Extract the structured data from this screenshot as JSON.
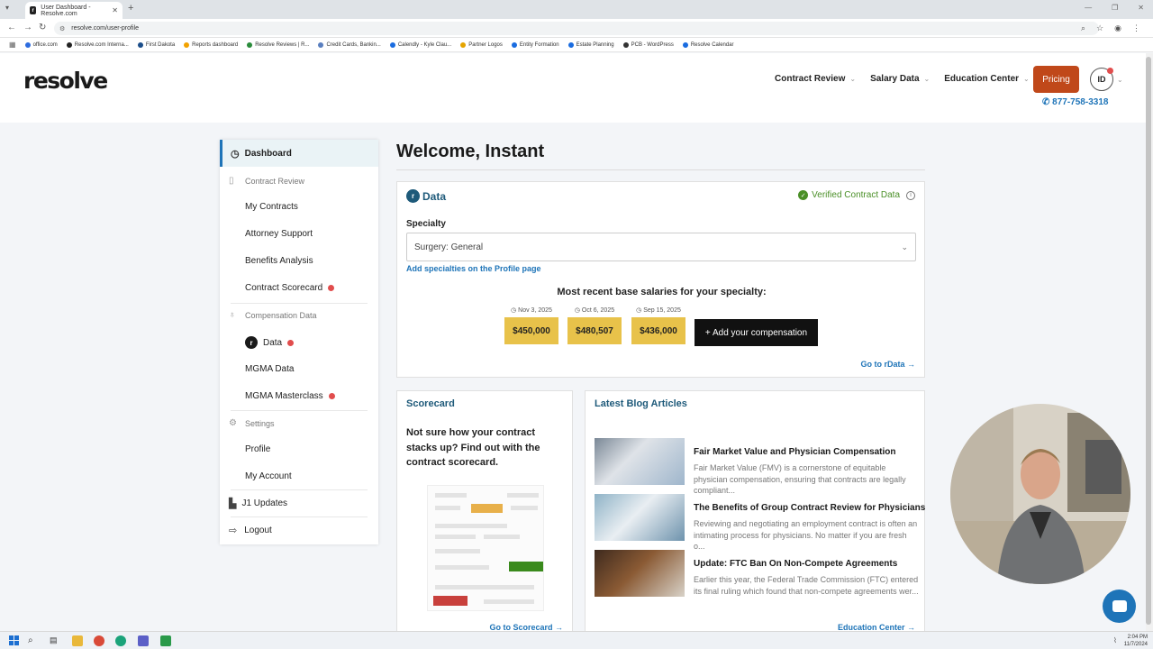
{
  "browser": {
    "tab_title": "User Dashboard - Resolve.com",
    "url": "resolve.com/user-profile",
    "bookmarks": [
      "office.com",
      "Resolve.com Interna...",
      "First Dakota",
      "Reports dashboard",
      "Resolve Reviews | R...",
      "Credit Cards, Bankin...",
      "Calendly - Kyle Clau...",
      "Partner Logos",
      "Entity Formation",
      "Estate Planning",
      "PCB - WordPress",
      "Resolve Calendar"
    ]
  },
  "header": {
    "logo": "resolve",
    "nav": [
      "Contract Review",
      "Salary Data",
      "Education Center"
    ],
    "pricing_label": "Pricing",
    "avatar_initials": "ID",
    "phone": "877-758-3318"
  },
  "sidebar": {
    "dashboard": "Dashboard",
    "contract_review_section": "Contract Review",
    "contract_items": [
      "My Contracts",
      "Attorney Support",
      "Benefits Analysis",
      "Contract Scorecard"
    ],
    "compensation_section": "Compensation Data",
    "comp_items": [
      "Data",
      "MGMA Data",
      "MGMA Masterclass"
    ],
    "settings_section": "Settings",
    "settings_items": [
      "Profile",
      "My Account"
    ],
    "j1_updates": "J1 Updates",
    "logout": "Logout"
  },
  "main": {
    "welcome": "Welcome, Instant",
    "rdata": {
      "badge": "r",
      "title": "Data",
      "verified": "Verified Contract Data",
      "specialty_label": "Specialty",
      "specialty_value": "Surgery: General",
      "add_specialties": "Add specialties on the Profile page",
      "recent_title": "Most recent base salaries for your specialty:",
      "salaries": [
        {
          "date": "Nov 3, 2025",
          "value": "$450,000"
        },
        {
          "date": "Oct 6, 2025",
          "value": "$480,507"
        },
        {
          "date": "Sep 15, 2025",
          "value": "$436,000"
        }
      ],
      "add_comp": "+  Add your compensation",
      "goto": "Go to rData →"
    },
    "scorecard": {
      "title": "Scorecard",
      "text": "Not sure how your contract stacks up? Find out with the contract scorecard.",
      "goto": "Go to Scorecard →"
    },
    "blog": {
      "title": "Latest Blog Articles",
      "articles": [
        {
          "title": "Fair Market Value and Physician Compensation",
          "excerpt": "Fair Market Value (FMV) is a cornerstone of equitable physician compensation, ensuring that contracts are legally compliant..."
        },
        {
          "title": "The Benefits of Group Contract Review for Physicians",
          "excerpt": "Reviewing and negotiating an employment contract is often an intimating process for physicians. No matter if you are fresh o..."
        },
        {
          "title": "Update: FTC Ban On Non-Compete Agreements",
          "excerpt": "Earlier this year, the Federal Trade Commission (FTC) entered its final ruling which found that non-compete agreements wer..."
        }
      ],
      "goto": "Education Center →"
    }
  },
  "taskbar": {
    "time": "2:04 PM",
    "date": "11/7/2024"
  },
  "colors": {
    "accent_blue": "#1e74b8",
    "pricing_orange": "#c0481a",
    "salary_gold": "#e8c24a",
    "verified_green": "#4a8f27",
    "alert_red": "#e14d4d"
  }
}
